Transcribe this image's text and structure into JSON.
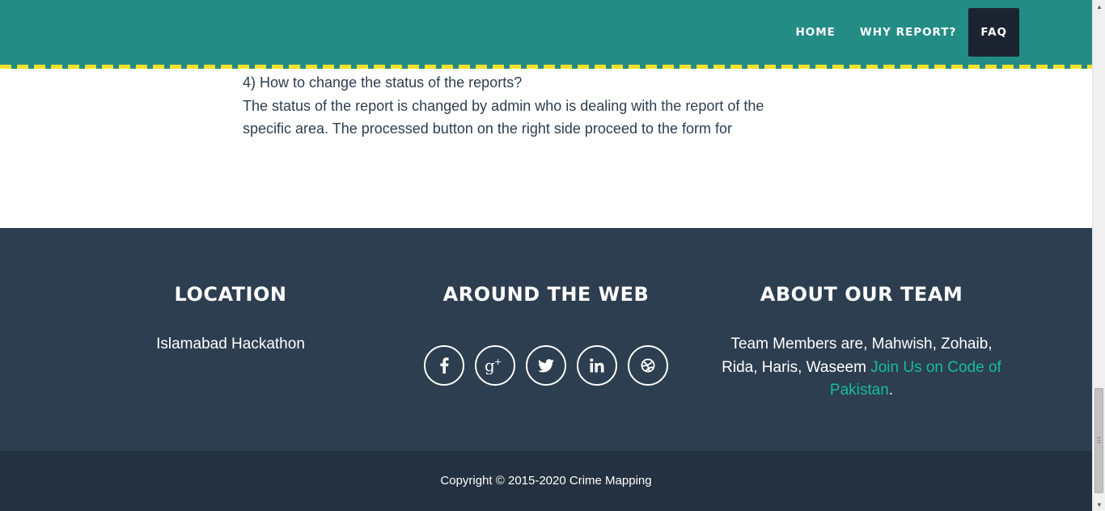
{
  "nav": {
    "links": [
      {
        "label": "HOME",
        "active": false
      },
      {
        "label": "WHY REPORT?",
        "active": false
      },
      {
        "label": "FAQ",
        "active": true
      }
    ]
  },
  "content": {
    "question": "4) How to change the status of the reports?",
    "answer_line_1": "The status of the report is changed by admin who is dealing with the report of the",
    "answer_line_2": "specific area. The processed button on the right side proceed to the form for"
  },
  "footer": {
    "location": {
      "heading": "LOCATION",
      "text": "Islamabad Hackathon"
    },
    "web": {
      "heading": "AROUND THE WEB",
      "socials": [
        "facebook-icon",
        "google-plus-icon",
        "twitter-icon",
        "linkedin-icon",
        "dribbble-icon"
      ]
    },
    "team": {
      "heading": "ABOUT OUR TEAM",
      "text": "Team Members are, Mahwish, Zohaib, Rida, Haris, Waseem",
      "link_text": "Join Us on Code of Pakistan",
      "trailing": "."
    },
    "copyright": "Copyright © 2015-2020 Crime Mapping"
  },
  "colors": {
    "navbar": "#238c85",
    "stripe": "#f3e12a",
    "active_nav": "#1b2430",
    "footer_above": "#2c3e50",
    "footer_below": "#233140",
    "link": "#18bc9c",
    "text": "#2c3e50"
  }
}
